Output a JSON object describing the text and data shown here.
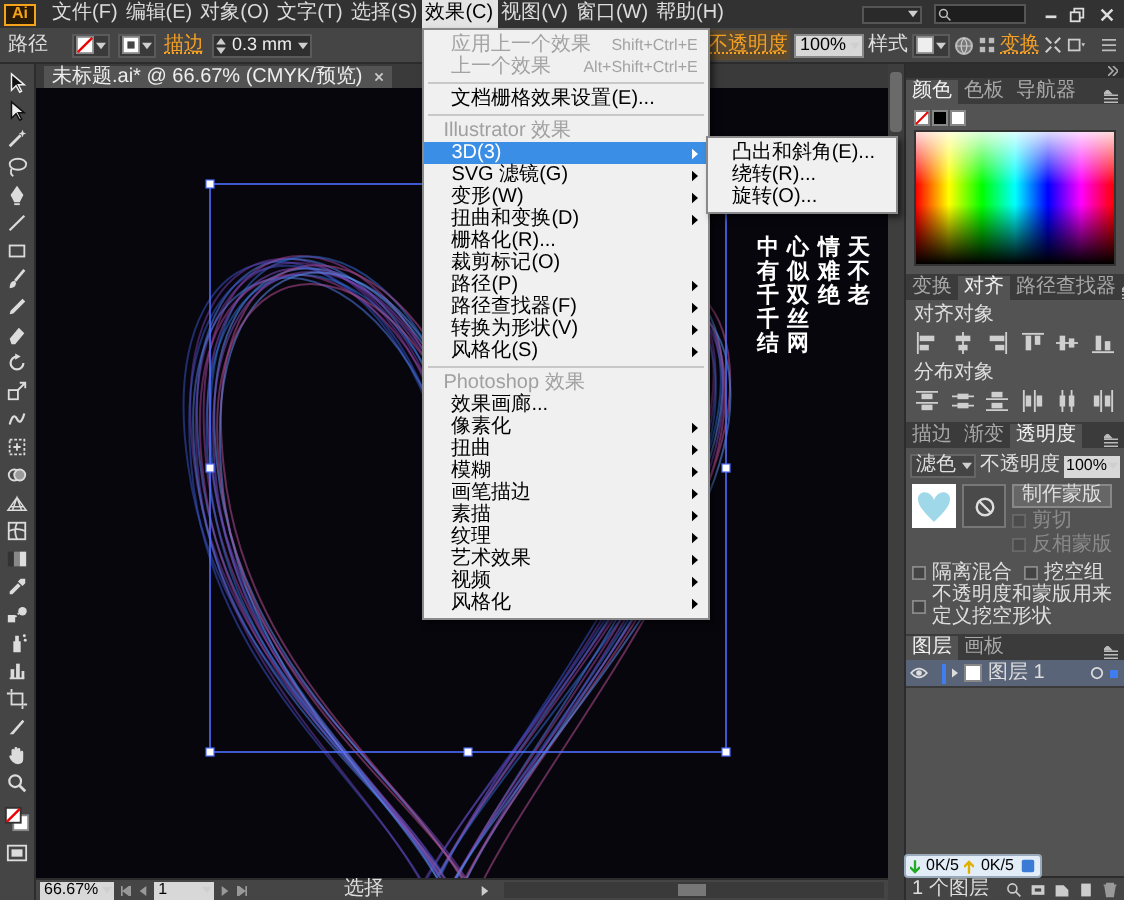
{
  "app_logo": "Ai",
  "menu_bar": {
    "items": [
      {
        "label": "文件(F)",
        "selected": false
      },
      {
        "label": "编辑(E)",
        "selected": false
      },
      {
        "label": "对象(O)",
        "selected": false
      },
      {
        "label": "文字(T)",
        "selected": false
      },
      {
        "label": "选择(S)",
        "selected": false
      },
      {
        "label": "效果(C)",
        "selected": true
      },
      {
        "label": "视图(V)",
        "selected": false
      },
      {
        "label": "窗口(W)",
        "selected": false
      },
      {
        "label": "帮助(H)",
        "selected": false
      }
    ]
  },
  "control_bar": {
    "object_type": "路径",
    "stroke_label": "描边",
    "stroke_weight": "0.3 mm",
    "opacity_label": "不透明度",
    "opacity": "100%",
    "style_label": "样式",
    "transform_label": "变换"
  },
  "document_tabs": [
    {
      "title": "未标题.ai* @ 66.67% (CMYK/预览)",
      "selected": true
    }
  ],
  "effect_menu": {
    "items": [
      {
        "kind": "item",
        "label": "应用上一个效果",
        "shortcut": "Shift+Ctrl+E",
        "disabled": true,
        "submenu": false,
        "selected": false
      },
      {
        "kind": "item",
        "label": "上一个效果",
        "shortcut": "Alt+Shift+Ctrl+E",
        "disabled": true,
        "submenu": false,
        "selected": false
      },
      {
        "kind": "separator"
      },
      {
        "kind": "item",
        "label": "文档栅格效果设置(E)...",
        "disabled": false,
        "submenu": false,
        "selected": false
      },
      {
        "kind": "separator"
      },
      {
        "kind": "header",
        "label": "Illustrator 效果"
      },
      {
        "kind": "item",
        "label": "3D(3)",
        "disabled": false,
        "submenu": true,
        "selected": true
      },
      {
        "kind": "item",
        "label": "SVG 滤镜(G)",
        "disabled": false,
        "submenu": true,
        "selected": false
      },
      {
        "kind": "item",
        "label": "变形(W)",
        "disabled": false,
        "submenu": true,
        "selected": false
      },
      {
        "kind": "item",
        "label": "扭曲和变换(D)",
        "disabled": false,
        "submenu": true,
        "selected": false
      },
      {
        "kind": "item",
        "label": "栅格化(R)...",
        "disabled": false,
        "submenu": false,
        "selected": false
      },
      {
        "kind": "item",
        "label": "裁剪标记(O)",
        "disabled": false,
        "submenu": false,
        "selected": false
      },
      {
        "kind": "item",
        "label": "路径(P)",
        "disabled": false,
        "submenu": true,
        "selected": false
      },
      {
        "kind": "item",
        "label": "路径查找器(F)",
        "disabled": false,
        "submenu": true,
        "selected": false
      },
      {
        "kind": "item",
        "label": "转换为形状(V)",
        "disabled": false,
        "submenu": true,
        "selected": false
      },
      {
        "kind": "item",
        "label": "风格化(S)",
        "disabled": false,
        "submenu": true,
        "selected": false
      },
      {
        "kind": "separator"
      },
      {
        "kind": "header",
        "label": "Photoshop 效果"
      },
      {
        "kind": "item",
        "label": "效果画廊...",
        "disabled": false,
        "submenu": false,
        "selected": false
      },
      {
        "kind": "item",
        "label": "像素化",
        "disabled": false,
        "submenu": true,
        "selected": false
      },
      {
        "kind": "item",
        "label": "扭曲",
        "disabled": false,
        "submenu": true,
        "selected": false
      },
      {
        "kind": "item",
        "label": "模糊",
        "disabled": false,
        "submenu": true,
        "selected": false
      },
      {
        "kind": "item",
        "label": "画笔描边",
        "disabled": false,
        "submenu": true,
        "selected": false
      },
      {
        "kind": "item",
        "label": "素描",
        "disabled": false,
        "submenu": true,
        "selected": false
      },
      {
        "kind": "item",
        "label": "纹理",
        "disabled": false,
        "submenu": true,
        "selected": false
      },
      {
        "kind": "item",
        "label": "艺术效果",
        "disabled": false,
        "submenu": true,
        "selected": false
      },
      {
        "kind": "item",
        "label": "视频",
        "disabled": false,
        "submenu": true,
        "selected": false
      },
      {
        "kind": "item",
        "label": "风格化",
        "disabled": false,
        "submenu": true,
        "selected": false
      }
    ]
  },
  "effect_submenu": {
    "items": [
      {
        "label": "凸出和斜角(E)..."
      },
      {
        "label": "绕转(R)..."
      },
      {
        "label": "旋转(O)..."
      }
    ]
  },
  "canvas": {
    "poem_columns": [
      "中有千千结",
      "心似双丝网",
      "情难绝",
      "天不老"
    ]
  },
  "panels": {
    "color": {
      "tabs": [
        {
          "label": "颜色",
          "selected": true
        },
        {
          "label": "色板",
          "selected": false
        },
        {
          "label": "导航器",
          "selected": false
        }
      ]
    },
    "align": {
      "tabs": [
        {
          "label": "变换",
          "selected": false
        },
        {
          "label": "对齐",
          "selected": true
        },
        {
          "label": "路径查找器",
          "selected": false
        }
      ],
      "align_label": "对齐对象",
      "distribute_label": "分布对象"
    },
    "transparency": {
      "tabs": [
        {
          "label": "描边",
          "selected": false
        },
        {
          "label": "渐变",
          "selected": false
        },
        {
          "label": "透明度",
          "selected": true
        }
      ],
      "blend_mode": "滤色",
      "opacity_label": "不透明度",
      "opacity": "100%",
      "make_mask": "制作蒙版",
      "mask_options": [
        {
          "label": "剪切",
          "checked": false,
          "disabled": true
        },
        {
          "label": "反相蒙版",
          "checked": false,
          "disabled": true
        }
      ],
      "options": [
        {
          "label": "隔离混合",
          "checked": false
        },
        {
          "label": "挖空组",
          "checked": false
        },
        {
          "label": "不透明度和蒙版用来定义挖空形状",
          "checked": false
        }
      ]
    },
    "layers": {
      "tabs": [
        {
          "label": "图层",
          "selected": true
        },
        {
          "label": "画板",
          "selected": false
        }
      ],
      "layers": [
        {
          "name": "图层 1",
          "visible": true,
          "selected": true
        }
      ],
      "layer_count": "1 个图层"
    }
  },
  "status_bar": {
    "zoom": "66.67%",
    "artboard": "1",
    "tool": "选择"
  },
  "network_widget": {
    "download": "0K/5",
    "upload": "0K/5"
  }
}
